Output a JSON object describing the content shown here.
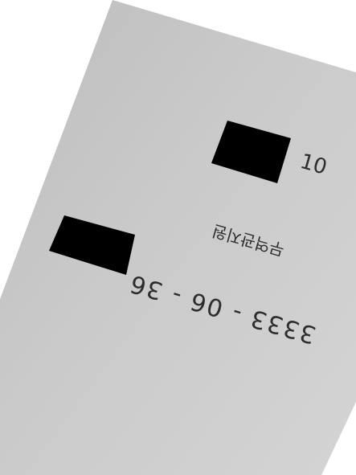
{
  "photo": {
    "subject": "",
    "paper_color": "#c9c9c9",
    "background_color": "#ffffff",
    "ink_color": "#2d2d2d",
    "redaction_color": "#000000"
  },
  "handwriting": {
    "number_top": "10",
    "korean_text": "무역관지원",
    "phone_number": "3333 - 06 - 36"
  }
}
